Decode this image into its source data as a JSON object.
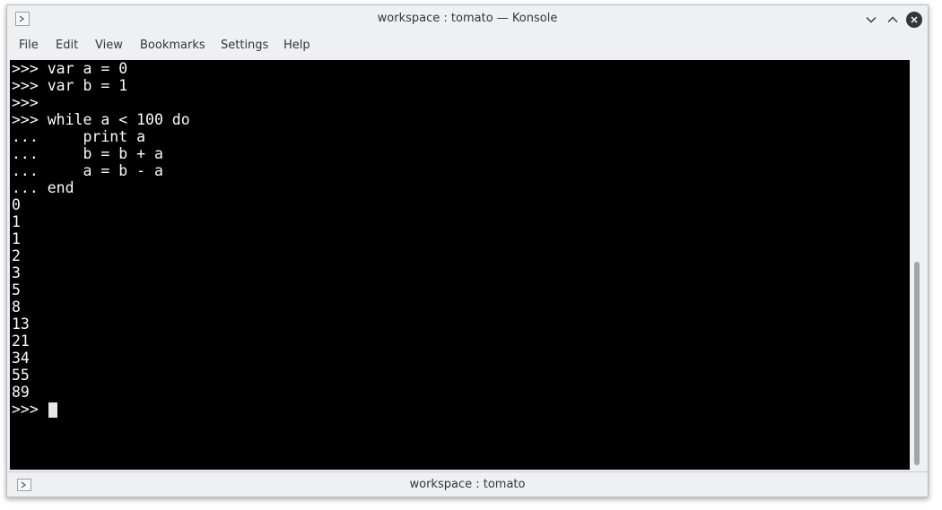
{
  "window": {
    "title": "workspace : tomato — Konsole",
    "icon": "konsole-terminal-icon"
  },
  "controls": {
    "minimize_icon": "chevron-down-icon",
    "maximize_icon": "chevron-up-icon",
    "close_icon": "close-icon"
  },
  "menubar": {
    "items": [
      {
        "label": "File"
      },
      {
        "label": "Edit"
      },
      {
        "label": "View"
      },
      {
        "label": "Bookmarks"
      },
      {
        "label": "Settings"
      },
      {
        "label": "Help"
      }
    ]
  },
  "terminal": {
    "lines": [
      ">>> var a = 0",
      ">>> var b = 1",
      ">>>",
      ">>> while a < 100 do",
      "...     print a",
      "...     b = b + a",
      "...     a = b - a",
      "... end",
      "0",
      "1",
      "1",
      "2",
      "3",
      "5",
      "8",
      "13",
      "21",
      "34",
      "55",
      "89",
      ">>> "
    ],
    "colors": {
      "background": "#000000",
      "foreground": "#fcfcfc"
    }
  },
  "tabbar": {
    "tab_label": "workspace : tomato"
  }
}
